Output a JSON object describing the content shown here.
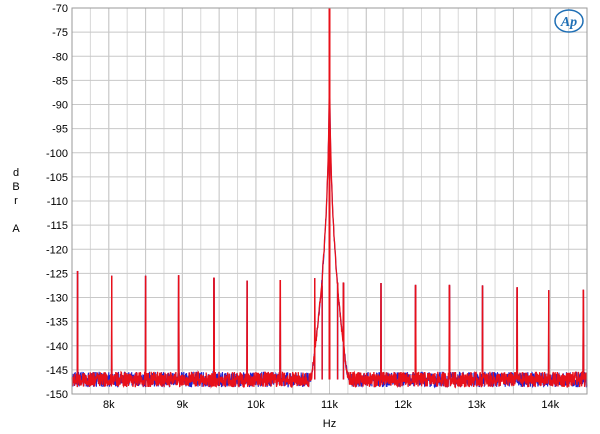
{
  "chart_data": {
    "type": "line",
    "title": "",
    "xlabel": "Hz",
    "ylabel_lines": [
      "d",
      "B",
      "r",
      "",
      "A"
    ],
    "xlim": [
      7500,
      14500
    ],
    "ylim": [
      -150,
      -70
    ],
    "y_ticks": [
      -70,
      -75,
      -80,
      -85,
      -90,
      -95,
      -100,
      -105,
      -110,
      -115,
      -120,
      -125,
      -130,
      -135,
      -140,
      -145,
      -150
    ],
    "y_tick_labels": [
      "-70",
      "-75",
      "-80",
      "-85",
      "-90",
      "-95",
      "-100",
      "-105",
      "-110",
      "-115",
      "-120",
      "-125",
      "-130",
      "-135",
      "-140",
      "-145",
      "-150"
    ],
    "x_ticks": [
      8000,
      9000,
      10000,
      11000,
      12000,
      13000,
      14000
    ],
    "x_tick_labels": [
      "8k",
      "9k",
      "10k",
      "11k",
      "12k",
      "13k",
      "14k"
    ],
    "x_minor_ticks": [
      7500,
      8500,
      9500,
      10500,
      11500,
      12500,
      13500,
      14500
    ],
    "grid": true,
    "noise_floor": -147,
    "series": [
      {
        "color": "#2020d0",
        "peaks": [
          [
            7575,
            -124.5
          ],
          [
            8040,
            -125.5
          ],
          [
            8500,
            -125.5
          ],
          [
            8950,
            -125.5
          ],
          [
            9430,
            -126
          ],
          [
            9880,
            -126.5
          ],
          [
            10330,
            -126.5
          ],
          [
            10800,
            -126
          ],
          [
            10900,
            -127.5
          ],
          [
            11000,
            -70
          ],
          [
            11110,
            -127
          ],
          [
            11190,
            -127
          ],
          [
            11700,
            -127
          ],
          [
            12170,
            -127.5
          ],
          [
            12630,
            -127.5
          ],
          [
            13080,
            -127.5
          ],
          [
            13550,
            -128
          ],
          [
            13980,
            -128.5
          ],
          [
            14450,
            -128.5
          ]
        ]
      },
      {
        "color": "#e8101a",
        "peaks": [
          [
            7575,
            -124.5
          ],
          [
            8040,
            -125.5
          ],
          [
            8500,
            -125.5
          ],
          [
            8950,
            -125.5
          ],
          [
            9430,
            -126
          ],
          [
            9880,
            -126.5
          ],
          [
            10330,
            -126.5
          ],
          [
            10800,
            -126
          ],
          [
            10900,
            -127.5
          ],
          [
            11000,
            -70
          ],
          [
            11110,
            -127
          ],
          [
            11190,
            -127
          ],
          [
            11700,
            -127
          ],
          [
            12170,
            -127.5
          ],
          [
            12630,
            -127.5
          ],
          [
            13080,
            -127.5
          ],
          [
            13550,
            -128
          ],
          [
            13980,
            -128.5
          ],
          [
            14450,
            -128.5
          ]
        ]
      }
    ]
  },
  "logo": {
    "text": "Ap",
    "color": "#1f6fb5"
  }
}
